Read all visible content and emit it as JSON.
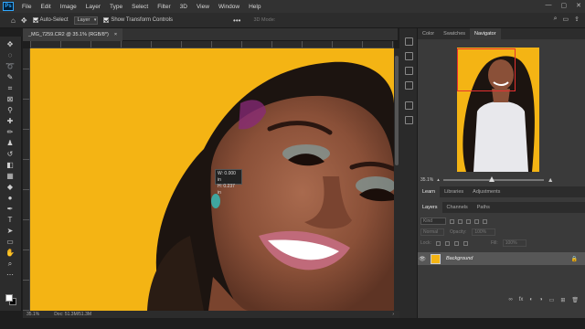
{
  "app": {
    "logo": "Ps"
  },
  "menu": [
    "File",
    "Edit",
    "Image",
    "Layer",
    "Type",
    "Select",
    "Filter",
    "3D",
    "View",
    "Window",
    "Help"
  ],
  "window_controls": {
    "minimize": "—",
    "maximize": "▢",
    "close": "✕"
  },
  "options_bar": {
    "auto_select_label": "Auto-Select",
    "target_value": "Layer",
    "transform_label": "Show Transform Controls",
    "mode_3d_label": "3D Mode:",
    "more": "•••"
  },
  "document": {
    "tab_title": "_MG_7259.CR2 @ 35.1% (RGB/8*)",
    "close_glyph": "×"
  },
  "measure_tooltip": {
    "w": "W: 0.000 in",
    "h": "H: 0.237 in"
  },
  "status": {
    "zoom": "35.1%",
    "doc_size": "Doc: 51.3M/51.3M"
  },
  "top_panel_tabs": [
    "Color",
    "Swatches",
    "Navigator"
  ],
  "navigator": {
    "zoom": "35.1%"
  },
  "mid_panel_tabs": [
    "Learn",
    "Libraries",
    "Adjustments"
  ],
  "layers_panel_tabs": [
    "Layers",
    "Channels",
    "Paths"
  ],
  "layers": {
    "kind_label": "Kind",
    "blend_mode": "Normal",
    "opacity_label": "Opacity:",
    "opacity_value": "100%",
    "lock_label": "Lock:",
    "fill_label": "Fill:",
    "fill_value": "100%",
    "items": [
      {
        "name": "Background",
        "visible_glyph": "👁",
        "lock_glyph": "🔒"
      }
    ]
  },
  "colors": {
    "canvas_bg": "#f4b414",
    "accent_red": "#e63030"
  }
}
